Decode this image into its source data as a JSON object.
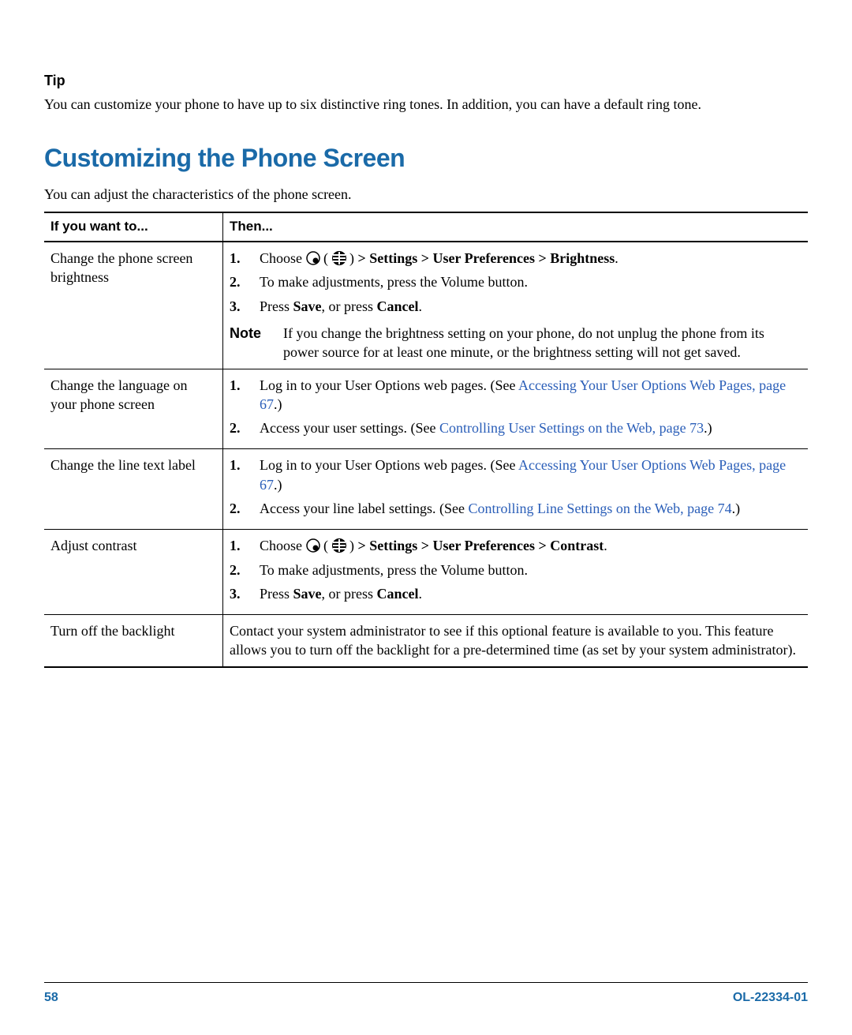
{
  "tip": {
    "label": "Tip",
    "body": "You can customize your phone to have up to six distinctive ring tones. In addition, you can have a default ring tone."
  },
  "section": {
    "title": "Customizing the Phone Screen",
    "intro": "You can adjust the characteristics of the phone screen."
  },
  "table": {
    "head_left": "If you want to...",
    "head_right": "Then...",
    "rows": {
      "r1": {
        "left": "Change the phone screen brightness",
        "s1a": "Choose ",
        "s1b": " > Settings > User Preferences > Brightness",
        "s2": "To make adjustments, press the Volume button.",
        "s3a": "Press ",
        "s3b": "Save",
        "s3c": ", or press ",
        "s3d": "Cancel",
        "note_label": "Note",
        "note": "If you change the brightness setting on your phone, do not unplug the phone from its power source for at least one minute, or the brightness setting will not get saved."
      },
      "r2": {
        "left": "Change the language on your phone screen",
        "s1a": "Log in to your User Options web pages. (See ",
        "s1link": "Accessing Your User Options Web Pages, page 67",
        "s1c": ".)",
        "s2a": "Access your user settings. (See ",
        "s2link": "Controlling User Settings on the Web, page 73",
        "s2c": ".)"
      },
      "r3": {
        "left": "Change the line text label",
        "s1a": "Log in to your User Options web pages. (See ",
        "s1link": "Accessing Your User Options Web Pages, page 67",
        "s1c": ".)",
        "s2a": "Access your line label settings. (See ",
        "s2link": "Controlling Line Settings on the Web, page 74",
        "s2c": ".)"
      },
      "r4": {
        "left": "Adjust contrast",
        "s1a": "Choose ",
        "s1b": " > Settings > User Preferences > Contrast",
        "s2": "To make adjustments, press the Volume button.",
        "s3a": "Press ",
        "s3b": "Save",
        "s3c": ", or press ",
        "s3d": "Cancel"
      },
      "r5": {
        "left": "Turn off the backlight",
        "body": "Contact your system administrator to see if this optional feature is available to you. This feature allows you to turn off the backlight for a pre-determined time (as set by your system administrator)."
      }
    }
  },
  "footer": {
    "page": "58",
    "doc": "OL-22334-01"
  }
}
